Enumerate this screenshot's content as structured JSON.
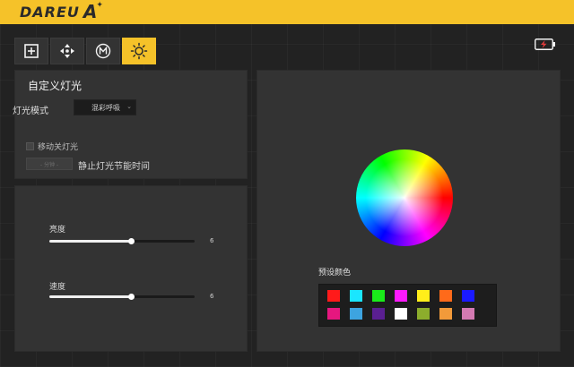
{
  "brand": {
    "logo_text": "DAREU",
    "logo_mark": "A",
    "logo_star": "✦"
  },
  "toolbar": [
    {
      "icon": "plus-square-icon",
      "active": false
    },
    {
      "icon": "dpad-move-icon",
      "active": false
    },
    {
      "icon": "macro-m-icon",
      "active": false
    },
    {
      "icon": "sun-light-icon",
      "active": true
    }
  ],
  "battery": {
    "icon": "battery-charging-icon",
    "accent": "#e33c3c"
  },
  "lighting": {
    "title": "自定义灯光",
    "mode_label": "灯光模式",
    "mode_value": "混彩呼吸",
    "move_off_label": "移动关灯光",
    "idle_placeholder": "- 分钟 -",
    "idle_label": "静止灯光节能时间"
  },
  "sliders": {
    "brightness": {
      "label": "亮度",
      "value": 6,
      "fraction": 0.56
    },
    "speed": {
      "label": "速度",
      "value": 6,
      "fraction": 0.56
    }
  },
  "color": {
    "preset_title": "预设颜色",
    "swatches": [
      [
        "#ff1a1a",
        "#1ae6ff",
        "#1aeb1a",
        "#ff1aff",
        "#ffee1a",
        "#ff6a1a",
        "#1a1aff"
      ],
      [
        "#e6177f",
        "#3da4e0",
        "#5a1f91",
        "#ffffff",
        "#8cad2c",
        "#f29a3a",
        "#d47ab2"
      ]
    ]
  },
  "theme": {
    "accent": "#f5c229",
    "panel": "#333333"
  }
}
